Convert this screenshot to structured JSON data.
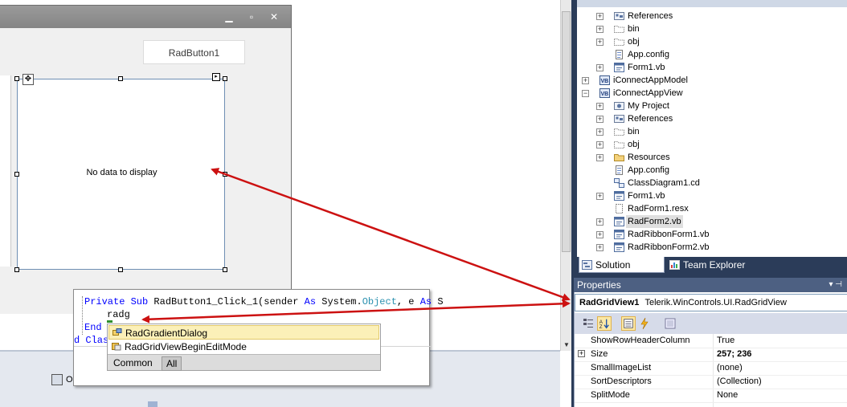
{
  "designer": {
    "button_label": "RadButton1",
    "grid_empty_text": "No data to display",
    "tray_item_label": "O"
  },
  "code_popup": {
    "line1": [
      {
        "t": "Private Sub ",
        "c": "kw"
      },
      {
        "t": "RadButton1_Click_1(sender ",
        "c": ""
      },
      {
        "t": "As ",
        "c": "kw"
      },
      {
        "t": "System.",
        "c": ""
      },
      {
        "t": "Object",
        "c": "ty"
      },
      {
        "t": ", e ",
        "c": ""
      },
      {
        "t": "As ",
        "c": "kw"
      },
      {
        "t": "S",
        "c": ""
      }
    ],
    "typed": "radg",
    "line3": "End",
    "line4_prefix": "d Clas"
  },
  "intellisense": {
    "items": [
      {
        "label": "RadGradientDialog",
        "selected": true
      },
      {
        "label": "RadGridViewBeginEditMode",
        "selected": false
      }
    ],
    "tabs": {
      "common": "Common",
      "all": "All"
    }
  },
  "solution_explorer": {
    "tree": [
      {
        "label": "References",
        "indent": 2,
        "expander": true,
        "icon": "references-icon"
      },
      {
        "label": "bin",
        "indent": 2,
        "expander": true,
        "icon": "folder-outline-icon"
      },
      {
        "label": "obj",
        "indent": 2,
        "expander": true,
        "icon": "folder-outline-icon"
      },
      {
        "label": "App.config",
        "indent": 2,
        "expander": false,
        "icon": "config-file-icon"
      },
      {
        "label": "Form1.vb",
        "indent": 2,
        "expander": true,
        "icon": "form-file-icon"
      },
      {
        "label": "iConnectAppModel",
        "indent": 1,
        "expander": true,
        "expanded": false,
        "icon": "vb-project-icon"
      },
      {
        "label": "iConnectAppView",
        "indent": 1,
        "expander": true,
        "expanded": true,
        "icon": "vb-project-icon"
      },
      {
        "label": "My Project",
        "indent": 2,
        "expander": true,
        "icon": "my-project-icon"
      },
      {
        "label": "References",
        "indent": 2,
        "expander": true,
        "icon": "references-icon"
      },
      {
        "label": "bin",
        "indent": 2,
        "expander": true,
        "icon": "folder-outline-icon"
      },
      {
        "label": "obj",
        "indent": 2,
        "expander": true,
        "icon": "folder-outline-icon"
      },
      {
        "label": "Resources",
        "indent": 2,
        "expander": true,
        "icon": "folder-icon"
      },
      {
        "label": "App.config",
        "indent": 2,
        "expander": false,
        "icon": "config-file-icon"
      },
      {
        "label": "ClassDiagram1.cd",
        "indent": 2,
        "expander": false,
        "icon": "class-diagram-icon"
      },
      {
        "label": "Form1.vb",
        "indent": 2,
        "expander": true,
        "icon": "form-file-icon"
      },
      {
        "label": "RadForm1.resx",
        "indent": 2,
        "expander": false,
        "icon": "resx-file-icon"
      },
      {
        "label": "RadForm2.vb",
        "indent": 2,
        "expander": true,
        "icon": "form-file-icon",
        "selected": true
      },
      {
        "label": "RadRibbonForm1.vb",
        "indent": 2,
        "expander": true,
        "icon": "form-file-icon"
      },
      {
        "label": "RadRibbonForm2.vb",
        "indent": 2,
        "expander": true,
        "icon": "form-file-icon"
      }
    ],
    "tabs": {
      "solution": "Solution Explorer",
      "team": "Team Explorer"
    }
  },
  "properties": {
    "title": "Properties",
    "header_controls": "▾ ⊣",
    "object_name": "RadGridView1",
    "object_type": "Telerik.WinControls.UI.RadGridView",
    "rows": [
      {
        "name": "ShowRowHeaderColumn",
        "value": "True",
        "bold": false,
        "expander": false
      },
      {
        "name": "Size",
        "value": "257; 236",
        "bold": true,
        "expander": true
      },
      {
        "name": "SmallImageList",
        "value": "(none)",
        "bold": false,
        "expander": false
      },
      {
        "name": "SortDescriptors",
        "value": "(Collection)",
        "bold": false,
        "expander": false
      },
      {
        "name": "SplitMode",
        "value": "None",
        "bold": false,
        "expander": false
      }
    ]
  },
  "colors": {
    "arrow": "#cc1111",
    "vs_dark_blue": "#2b3c59",
    "selection_yellow": "#fbf0b8"
  }
}
